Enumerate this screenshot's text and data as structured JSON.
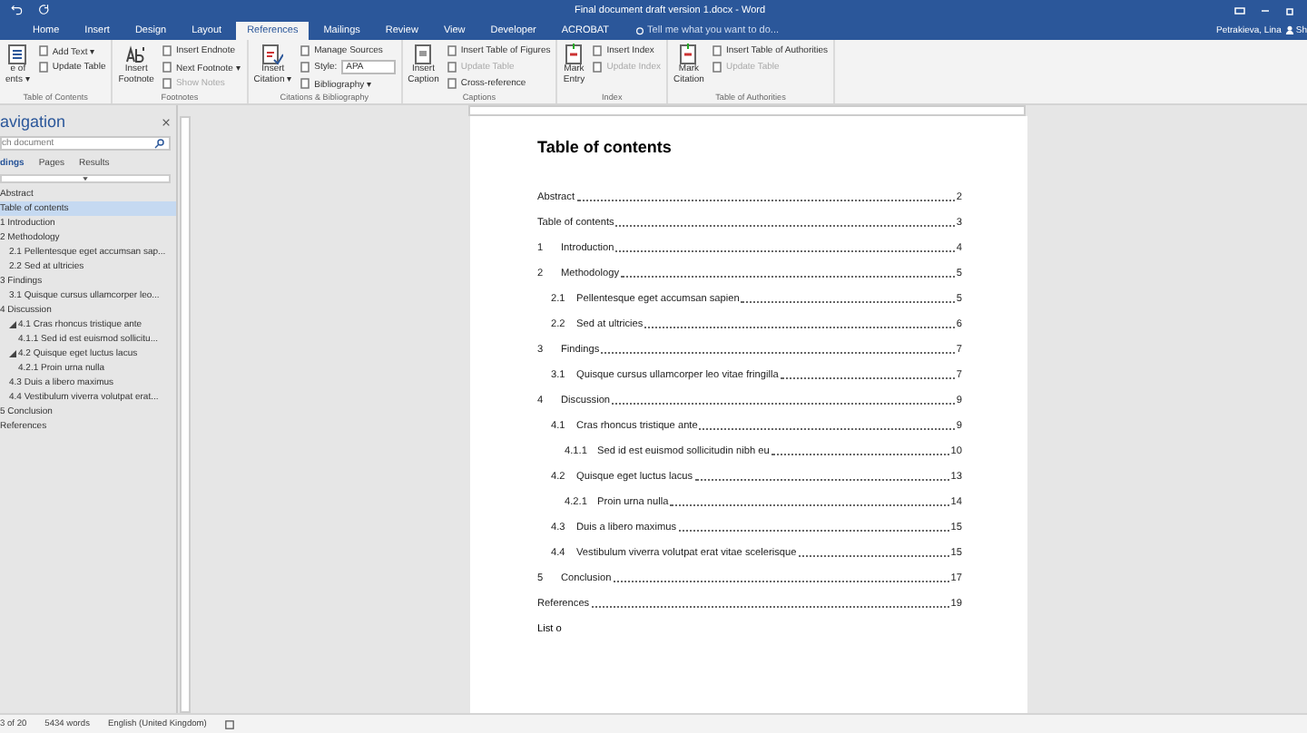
{
  "window": {
    "title": "Final document draft version 1.docx - Word",
    "user": "Petrakieva, Lina",
    "share": "Sh"
  },
  "tabs": [
    {
      "label": "Home",
      "selected": false
    },
    {
      "label": "Insert",
      "selected": false
    },
    {
      "label": "Design",
      "selected": false
    },
    {
      "label": "Layout",
      "selected": false
    },
    {
      "label": "References",
      "selected": true
    },
    {
      "label": "Mailings",
      "selected": false
    },
    {
      "label": "Review",
      "selected": false
    },
    {
      "label": "View",
      "selected": false
    },
    {
      "label": "Developer",
      "selected": false
    },
    {
      "label": "ACROBAT",
      "selected": false
    }
  ],
  "tell_me": {
    "placeholder": "Tell me what you want to do..."
  },
  "ribbon": [
    {
      "label": "Table of Contents",
      "big": {
        "label": "e of\nents ▾",
        "kind": "toc"
      },
      "small": [
        {
          "label": "Add Text ▾",
          "disabled": false
        },
        {
          "label": "Update Table",
          "disabled": false
        }
      ]
    },
    {
      "label": "Footnotes",
      "big": {
        "label": "Insert\nFootnote",
        "kind": "footnote"
      },
      "small": [
        {
          "label": "Insert Endnote",
          "disabled": false
        },
        {
          "label": "Next Footnote ▾",
          "disabled": false
        },
        {
          "label": "Show Notes",
          "disabled": true
        }
      ]
    },
    {
      "label": "Citations & Bibliography",
      "big": {
        "label": "Insert\nCitation ▾",
        "kind": "citation"
      },
      "small": [
        {
          "label": "Manage Sources",
          "disabled": false
        },
        {
          "label": "Style:",
          "disabled": false,
          "select": "APA"
        },
        {
          "label": "Bibliography ▾",
          "disabled": false
        }
      ]
    },
    {
      "label": "Captions",
      "big": {
        "label": "Insert\nCaption",
        "kind": "caption"
      },
      "small": [
        {
          "label": "Insert Table of Figures",
          "disabled": false
        },
        {
          "label": "Update Table",
          "disabled": true
        },
        {
          "label": "Cross-reference",
          "disabled": false
        }
      ]
    },
    {
      "label": "Index",
      "big": {
        "label": "Mark\nEntry",
        "kind": "mark"
      },
      "small": [
        {
          "label": "Insert Index",
          "disabled": false
        },
        {
          "label": "Update Index",
          "disabled": true
        }
      ]
    },
    {
      "label": "Table of Authorities",
      "big": {
        "label": "Mark\nCitation",
        "kind": "mark"
      },
      "small": [
        {
          "label": "Insert Table of Authorities",
          "disabled": false
        },
        {
          "label": "Update Table",
          "disabled": true
        }
      ]
    }
  ],
  "navigation": {
    "title": "avigation",
    "search": {
      "placeholder": "ch document"
    },
    "tabs": [
      {
        "label": "dings",
        "selected": true
      },
      {
        "label": "Pages",
        "selected": false
      },
      {
        "label": "Results",
        "selected": false
      }
    ],
    "items": [
      {
        "label": "Abstract",
        "selected": false
      },
      {
        "label": "Table of contents",
        "selected": true
      },
      {
        "label": "1 Introduction",
        "selected": false
      },
      {
        "label": "2 Methodology",
        "selected": false,
        "children": [
          {
            "label": "2.1 Pellentesque eget accumsan sap...",
            "selected": false
          },
          {
            "label": "2.2 Sed at ultricies",
            "selected": false
          }
        ]
      },
      {
        "label": "3 Findings",
        "selected": false,
        "children": [
          {
            "label": "3.1 Quisque cursus ullamcorper leo...",
            "selected": false
          }
        ]
      },
      {
        "label": "4 Discussion",
        "selected": false,
        "children": [
          {
            "label": "4.1 Cras rhoncus tristique ante",
            "selected": false,
            "expanded": true,
            "children": [
              {
                "label": "4.1.1 Sed id est euismod sollicitu...",
                "selected": false
              }
            ]
          },
          {
            "label": "4.2 Quisque eget luctus lacus",
            "selected": false,
            "expanded": true,
            "children": [
              {
                "label": "4.2.1 Proin urna nulla",
                "selected": false
              }
            ]
          },
          {
            "label": "4.3 Duis a libero maximus",
            "selected": false
          },
          {
            "label": "4.4 Vestibulum viverra volutpat erat...",
            "selected": false
          }
        ]
      },
      {
        "label": "5 Conclusion",
        "selected": false
      },
      {
        "label": "References",
        "selected": false
      }
    ]
  },
  "document": {
    "heading": "Table of contents",
    "toc": [
      {
        "title": "Abstract",
        "page": "2"
      },
      {
        "title": "Table of contents",
        "page": "3"
      },
      {
        "number": "1",
        "title": "Introduction",
        "page": "4"
      },
      {
        "number": "2",
        "title": "Methodology",
        "page": "5",
        "children": [
          {
            "number": "2.1",
            "title": "Pellentesque eget accumsan sapien",
            "page": "5"
          },
          {
            "number": "2.2",
            "title": "Sed at ultricies",
            "page": "6"
          }
        ]
      },
      {
        "number": "3",
        "title": "Findings",
        "page": "7",
        "children": [
          {
            "number": "3.1",
            "title": "Quisque cursus ullamcorper leo vitae fringilla",
            "page": "7"
          }
        ]
      },
      {
        "number": "4",
        "title": "Discussion",
        "page": "9",
        "children": [
          {
            "number": "4.1",
            "title": "Cras rhoncus tristique ante",
            "page": "9",
            "children": [
              {
                "number": "4.1.1",
                "title": "Sed id est euismod sollicitudin nibh eu",
                "page": "10"
              }
            ]
          },
          {
            "number": "4.2",
            "title": "Quisque eget luctus lacus",
            "page": "13",
            "children": [
              {
                "number": "4.2.1",
                "title": "Proin urna nulla",
                "page": "14"
              }
            ]
          },
          {
            "number": "4.3",
            "title": "Duis a libero maximus",
            "page": "15"
          },
          {
            "number": "4.4",
            "title": "Vestibulum viverra volutpat erat vitae scelerisque",
            "page": "15"
          }
        ]
      },
      {
        "number": "5",
        "title": "Conclusion",
        "page": "17"
      },
      {
        "title": "References",
        "page": "19"
      }
    ],
    "typing": "List o"
  },
  "status_bar": [
    "3 of 20",
    "5434 words",
    "English (United Kingdom)"
  ]
}
